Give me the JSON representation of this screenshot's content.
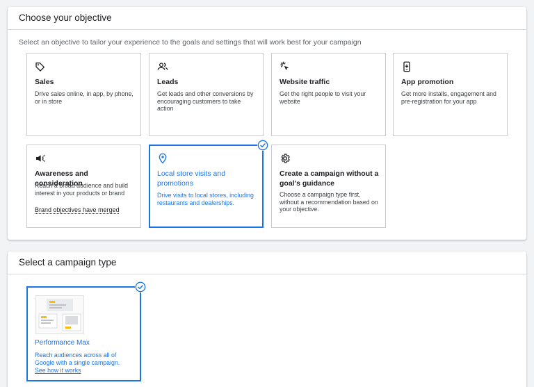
{
  "objective_panel": {
    "title": "Choose your objective",
    "subtitle": "Select an objective to tailor your experience to the goals and settings that will work best for your campaign",
    "cards": [
      {
        "title": "Sales",
        "desc": "Drive sales online, in app, by phone, or in store",
        "icon": "tag-icon"
      },
      {
        "title": "Leads",
        "desc": "Get leads and other conversions by encouraging customers to take action",
        "icon": "people-icon"
      },
      {
        "title": "Website traffic",
        "desc": "Get the right people to visit your website",
        "icon": "cursor-click-icon"
      },
      {
        "title": "App promotion",
        "desc": "Get more installs, engagement and pre-registration for your app",
        "icon": "phone-icon"
      },
      {
        "title": "Awareness and consideration",
        "desc": "Reach a broad audience and build interest in your products or brand",
        "link": "Brand objectives have merged",
        "icon": "megaphone-icon"
      },
      {
        "title": "Local store visits and promotions",
        "desc": "Drive visits to local stores, including restaurants and dealerships.",
        "icon": "location-pin-icon",
        "selected": true
      },
      {
        "title": "Create a campaign without a goal's guidance",
        "desc": "Choose a campaign type first, without a recommendation based on your objective.",
        "icon": "gear-icon"
      }
    ]
  },
  "campaign_panel": {
    "title": "Select a campaign type",
    "card": {
      "title": "Performance Max",
      "desc": "Reach audiences across all of Google with a single campaign.",
      "link": "See how it works",
      "selected": true
    }
  },
  "colors": {
    "accent": "#1a73e8",
    "border": "#c8cace",
    "background": "#f1f3f4"
  }
}
